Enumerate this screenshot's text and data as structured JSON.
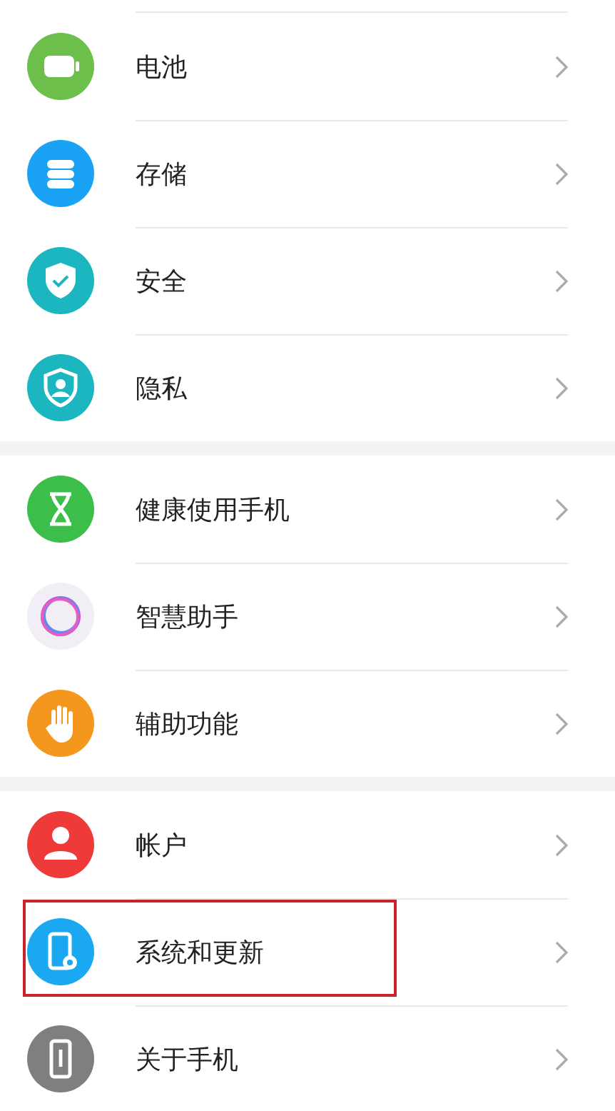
{
  "groups": [
    {
      "items": [
        {
          "label": "电池",
          "color": "#6cbf4a",
          "highlighted": false
        },
        {
          "label": "存储",
          "color": "#1aa3f5",
          "highlighted": false
        },
        {
          "label": "安全",
          "color": "#1bb6bf",
          "highlighted": false
        },
        {
          "label": "隐私",
          "color": "#1bb6bf",
          "highlighted": false
        }
      ]
    },
    {
      "items": [
        {
          "label": "健康使用手机",
          "color": "#3cbf4a",
          "highlighted": false
        },
        {
          "label": "智慧助手",
          "color": "#f1eef6",
          "highlighted": false
        },
        {
          "label": "辅助功能",
          "color": "#f5961d",
          "highlighted": false
        }
      ]
    },
    {
      "items": [
        {
          "label": "帐户",
          "color": "#ef3a3a",
          "highlighted": false
        },
        {
          "label": "系统和更新",
          "color": "#1aa8f0",
          "highlighted": true
        },
        {
          "label": "关于手机",
          "color": "#7f7f7f",
          "highlighted": false
        }
      ]
    }
  ]
}
